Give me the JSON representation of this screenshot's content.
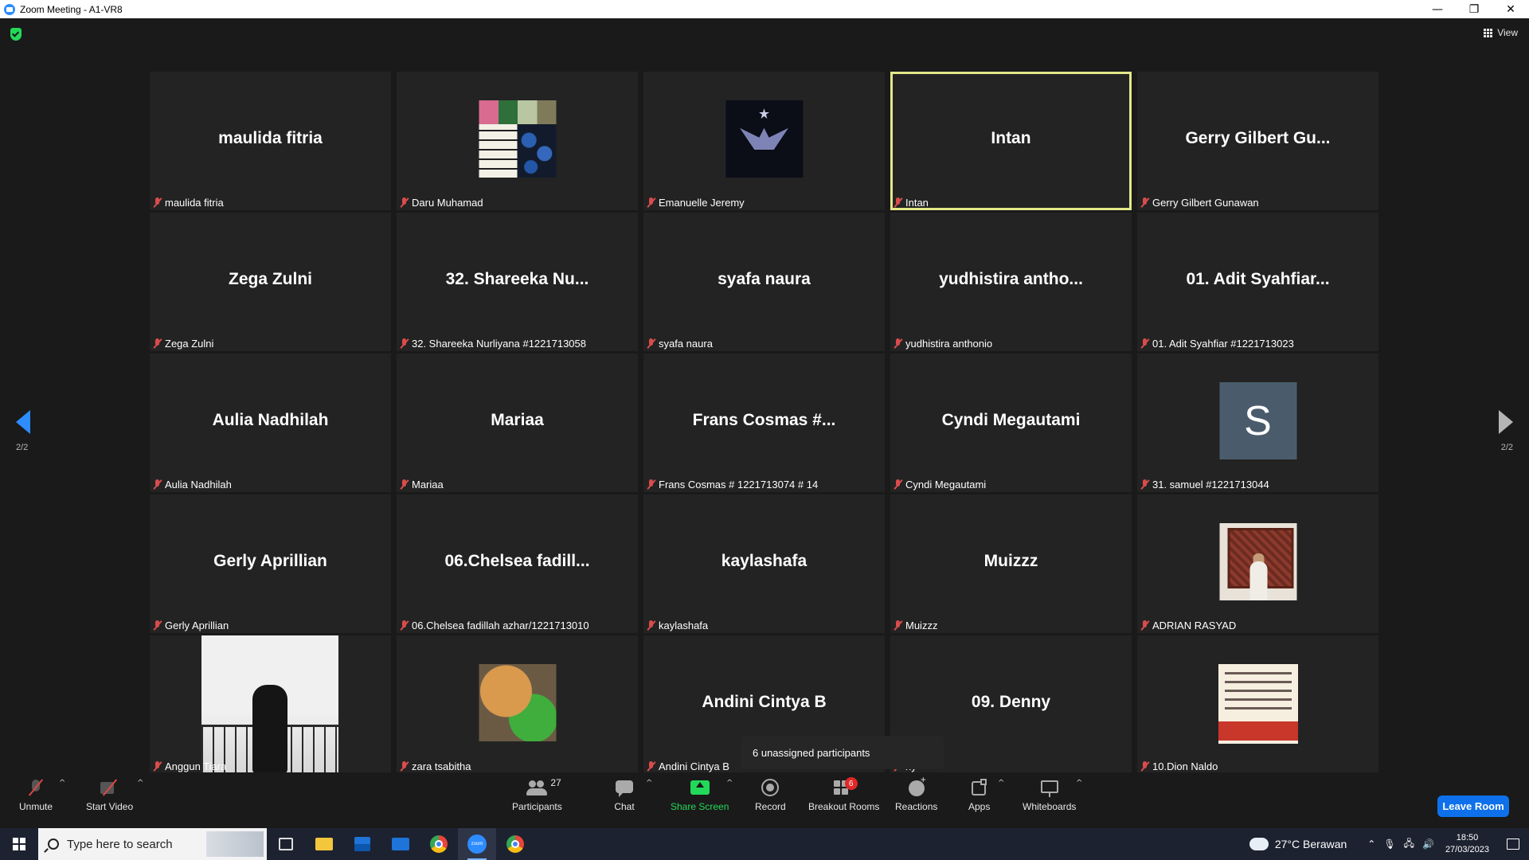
{
  "window": {
    "title": "Zoom Meeting - A1-VR8",
    "minimize": "—",
    "maximize": "❐",
    "close": "✕"
  },
  "view_button": {
    "label": "View"
  },
  "pagination": {
    "left": "2/2",
    "right": "2/2"
  },
  "tiles": [
    {
      "display": "maulida fitria",
      "label": "maulida fitria"
    },
    {
      "display": "",
      "label": "Daru Muhamad"
    },
    {
      "display": "",
      "label": "Emanuelle Jeremy"
    },
    {
      "display": "Intan",
      "label": "Intan",
      "active_speaker": true
    },
    {
      "display": "Gerry Gilbert Gu...",
      "label": "Gerry Gilbert Gunawan"
    },
    {
      "display": "Zega Zulni",
      "label": "Zega Zulni"
    },
    {
      "display": "32. Shareeka Nu...",
      "label": "32. Shareeka Nurliyana #1221713058"
    },
    {
      "display": "syafa naura",
      "label": "syafa naura"
    },
    {
      "display": "yudhistira antho...",
      "label": "yudhistira anthonio"
    },
    {
      "display": "01. Adit Syahfiar...",
      "label": "01. Adit Syahfiar #1221713023"
    },
    {
      "display": "Aulia Nadhilah",
      "label": "Aulia Nadhilah"
    },
    {
      "display": "Mariaa",
      "label": "Mariaa"
    },
    {
      "display": "Frans Cosmas #...",
      "label": "Frans Cosmas # 1221713074 # 14"
    },
    {
      "display": "Cyndi Megautami",
      "label": "Cyndi Megautami"
    },
    {
      "display": "S",
      "label": "31. samuel #1221713044"
    },
    {
      "display": "Gerly Aprillian",
      "label": "Gerly Aprillian"
    },
    {
      "display": "06.Chelsea fadill...",
      "label": "06.Chelsea fadillah azhar/1221713010"
    },
    {
      "display": "kaylashafa",
      "label": "kaylashafa"
    },
    {
      "display": "Muizzz",
      "label": "Muizzz"
    },
    {
      "display": "",
      "label": "ADRIAN RASYAD"
    },
    {
      "display": "",
      "label": "Anggun Tiara"
    },
    {
      "display": "",
      "label": "zara tsabitha"
    },
    {
      "display": "Andini Cintya B",
      "label": "Andini Cintya B"
    },
    {
      "display": "09. Denny",
      "label": "ny"
    },
    {
      "display": "",
      "label": "10.Dion Naldo"
    }
  ],
  "popover": {
    "text": "6 unassigned participants"
  },
  "toolbar": {
    "unmute": "Unmute",
    "start_video": "Start Video",
    "participants": "Participants",
    "participants_count": "27",
    "chat": "Chat",
    "share_screen": "Share Screen",
    "record": "Record",
    "breakout_rooms": "Breakout Rooms",
    "breakout_badge": "6",
    "reactions": "Reactions",
    "apps": "Apps",
    "whiteboards": "Whiteboards",
    "leave": "Leave Room",
    "caret": "^"
  },
  "taskbar": {
    "search_placeholder": "Type here to search",
    "zoom_icon_text": "zoom",
    "weather": "27°C  Berawan",
    "time": "18:50",
    "date": "27/03/2023"
  },
  "colors": {
    "accent": "#2d8cff",
    "share_green": "#23d959",
    "leave_blue": "#0e71eb",
    "active_border": "#e3e88a",
    "muted_red": "#d94c4c"
  }
}
